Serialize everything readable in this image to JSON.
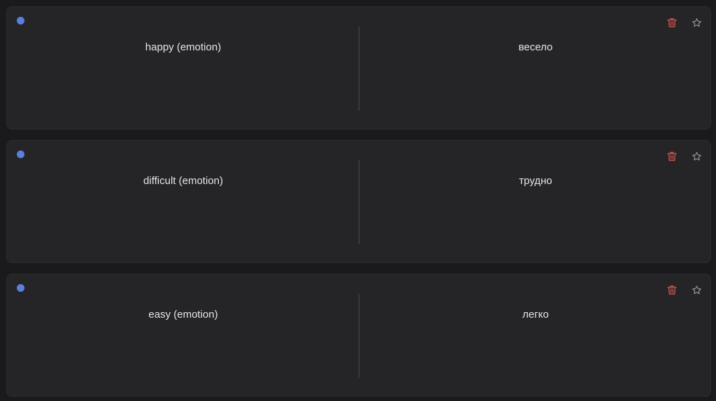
{
  "colors": {
    "dot": "#5b7fdc",
    "delete": "#c0504a",
    "star": "#9a9a9e"
  },
  "icons": {
    "status": "status-dot-icon",
    "delete": "trash-icon",
    "favorite": "star-icon"
  },
  "cards": [
    {
      "front": "happy (emotion)",
      "back": "весело"
    },
    {
      "front": "difficult (emotion)",
      "back": "трудно"
    },
    {
      "front": "easy (emotion)",
      "back": "легко"
    }
  ]
}
